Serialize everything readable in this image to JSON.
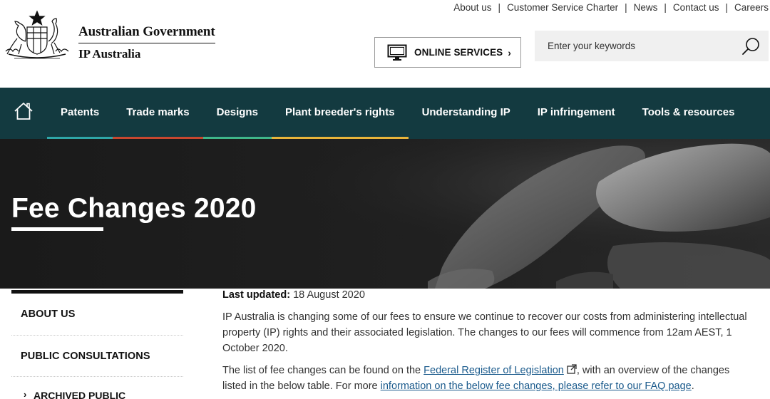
{
  "utility_nav": [
    "About us",
    "Customer Service Charter",
    "News",
    "Contact us",
    "Careers"
  ],
  "brand": {
    "government": "Australian Government",
    "agency": "IP Australia",
    "crest_icon": "coat-of-arms-icon"
  },
  "online_services": {
    "label": "ONLINE SERVICES",
    "icon": "monitor-icon",
    "chevron": "›"
  },
  "search": {
    "placeholder": "Enter your keywords",
    "icon": "search-icon"
  },
  "main_nav": {
    "home_icon": "home-icon",
    "background": "#133a40",
    "items": [
      {
        "label": "Patents",
        "accent": "#2fa6a8"
      },
      {
        "label": "Trade marks",
        "accent": "#c8472f"
      },
      {
        "label": "Designs",
        "accent": "#3fb68a"
      },
      {
        "label": "Plant breeder's rights",
        "accent": "#e8b43a"
      },
      {
        "label": "Understanding IP",
        "accent": ""
      },
      {
        "label": "IP infringement",
        "accent": ""
      },
      {
        "label": "Tools & resources",
        "accent": ""
      }
    ]
  },
  "hero": {
    "title": "Fee Changes 2020"
  },
  "sidebar": {
    "items": [
      "ABOUT US",
      "PUBLIC CONSULTATIONS"
    ],
    "sub_item": "ARCHIVED PUBLIC"
  },
  "content": {
    "updated_label": "Last updated:",
    "updated_value": "18 August 2020",
    "para1": "IP Australia is changing some of our fees to ensure we continue to recover our costs from administering intellectual property (IP) rights and their associated legislation. The changes to our fees will commence from 12am AEST, 1 October 2020.",
    "para2_before": "The list of fee changes can be found on the ",
    "para2_link1": "Federal Register of Legislation",
    "para2_middle": ", with an overview of the changes listed in the below table. For more ",
    "para2_link2": "information on the below fee changes, please refer to our FAQ page",
    "para2_after": "."
  }
}
